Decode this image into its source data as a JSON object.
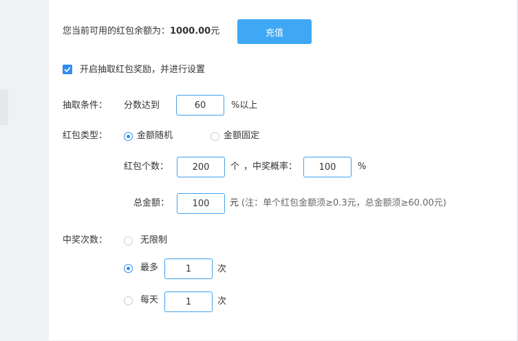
{
  "balance": {
    "label": "您当前可用的红包余额为：",
    "amount": "1000.00",
    "unit": "元",
    "recharge_label": "充值"
  },
  "enable": {
    "checked": true,
    "label": "开启抽取红包奖励，并进行设置"
  },
  "condition": {
    "label": "抽取条件：",
    "prefix": "分数达到",
    "value": "60",
    "suffix": "%以上"
  },
  "type": {
    "label": "红包类型：",
    "options": [
      {
        "label": "金额随机",
        "selected": true
      },
      {
        "label": "金额固定",
        "selected": false
      }
    ]
  },
  "count": {
    "label": "红包个数：",
    "value": "200",
    "unit": "个",
    "rate_label": "，中奖概率：",
    "rate_value": "100",
    "rate_unit": "%"
  },
  "total": {
    "label": "总金额：",
    "value": "100",
    "unit": "元",
    "note": "(注：单个红包金额须≥0.3元，总金额须≥60.00元)"
  },
  "times": {
    "label": "中奖次数：",
    "options": [
      {
        "label": "无限制",
        "selected": false
      },
      {
        "label": "最多",
        "selected": true,
        "value": "1",
        "unit": "次"
      },
      {
        "label": "每天",
        "selected": false,
        "value": "1",
        "unit": "次"
      }
    ]
  },
  "colors": {
    "primary": "#3fa8f4",
    "checkbox": "#2f8cf0",
    "input_border": "#3fa0ee"
  }
}
